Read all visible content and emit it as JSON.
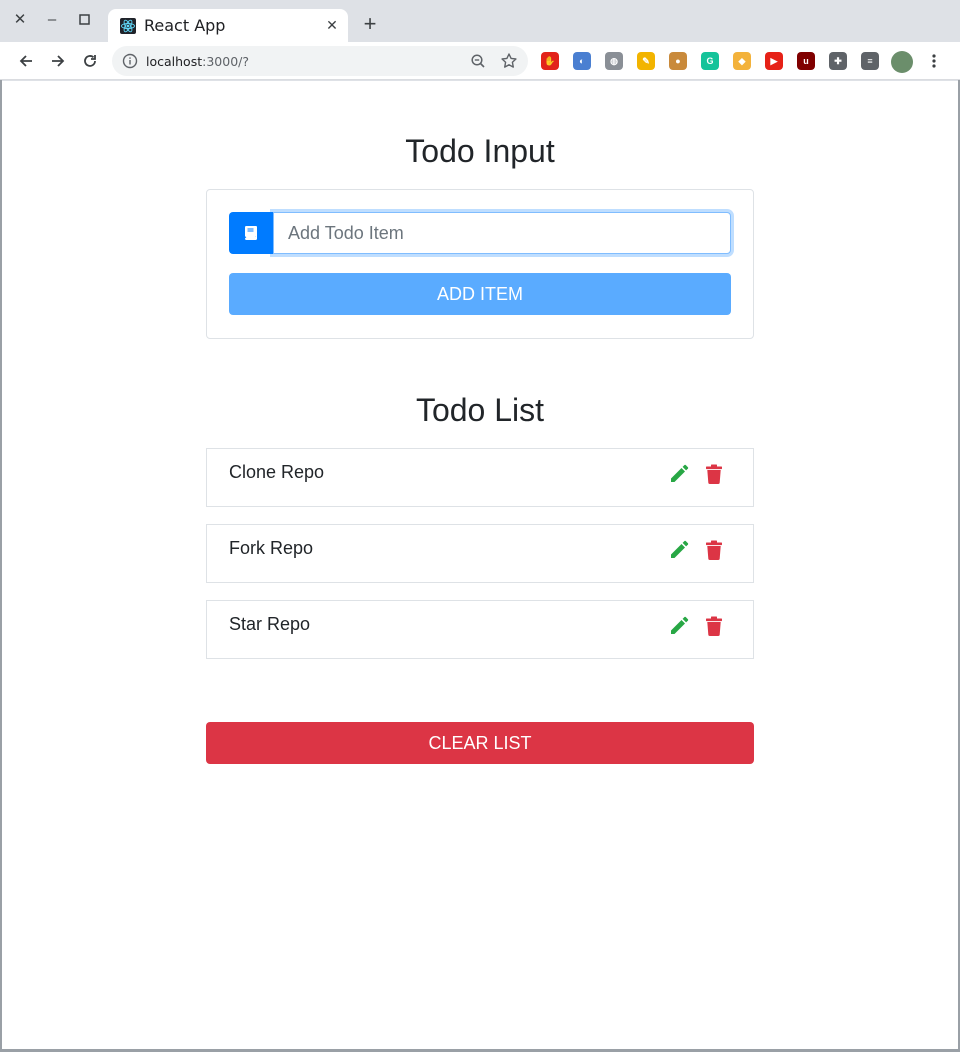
{
  "browser": {
    "tab_title": "React App",
    "url_host": "localhost",
    "url_rest": ":3000/?",
    "accent_color": "#1a73e8"
  },
  "extensions": [
    {
      "name": "adblock-icon",
      "color": "#e2231a",
      "glyph": "✋"
    },
    {
      "name": "extension-blue-icon",
      "color": "#4a7fd1",
      "glyph": "◐"
    },
    {
      "name": "globe-icon",
      "color": "#8a8f96",
      "glyph": "◍"
    },
    {
      "name": "highlighter-icon",
      "color": "#f2b400",
      "glyph": "✎"
    },
    {
      "name": "cookie-icon",
      "color": "#c98a3b",
      "glyph": "●"
    },
    {
      "name": "grammarly-icon",
      "color": "#15c39a",
      "glyph": "G"
    },
    {
      "name": "extension-map-icon",
      "color": "#f3b23b",
      "glyph": "◆"
    },
    {
      "name": "youtube-extension-icon",
      "color": "#e62117",
      "glyph": "▶"
    },
    {
      "name": "ublock-icon",
      "color": "#800000",
      "glyph": "u"
    },
    {
      "name": "puzzle-icon",
      "color": "#5f6368",
      "glyph": "✚"
    },
    {
      "name": "media-list-icon",
      "color": "#5f6368",
      "glyph": "≡"
    }
  ],
  "page": {
    "input_section_title": "Todo Input",
    "input_placeholder": "Add Todo Item",
    "input_value": "",
    "add_button_label": "ADD ITEM",
    "list_section_title": "Todo List",
    "items": [
      {
        "text": "Clone Repo"
      },
      {
        "text": "Fork Repo"
      },
      {
        "text": "Star Repo"
      }
    ],
    "clear_button_label": "CLEAR LIST"
  },
  "colors": {
    "primary": "#007bff",
    "add_button": "#5aabff",
    "edit": "#28a745",
    "danger": "#dc3545",
    "text": "#212529"
  }
}
